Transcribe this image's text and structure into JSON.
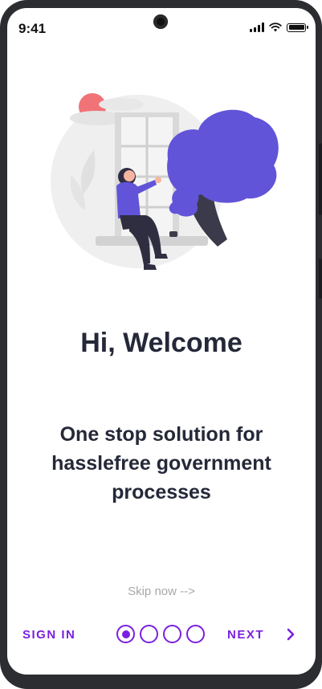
{
  "status_bar": {
    "time": "9:41"
  },
  "illustration": {
    "icon": "woman-at-window-illustration"
  },
  "onboarding": {
    "title": "Hi, Welcome",
    "subtitle_line1": "One stop solution for",
    "subtitle_line2": "hasslefree government",
    "subtitle_line3": "processes",
    "skip_label": "Skip now -->"
  },
  "footer": {
    "sign_in_label": "SIGN IN",
    "next_label": "NEXT",
    "page_indicator": {
      "total": 4,
      "current": 1
    }
  },
  "colors": {
    "accent": "#7a1fe0",
    "text": "#252838",
    "muted": "#a8a8a8",
    "illustration_primary": "#6154d8",
    "sun": "#f07378"
  }
}
